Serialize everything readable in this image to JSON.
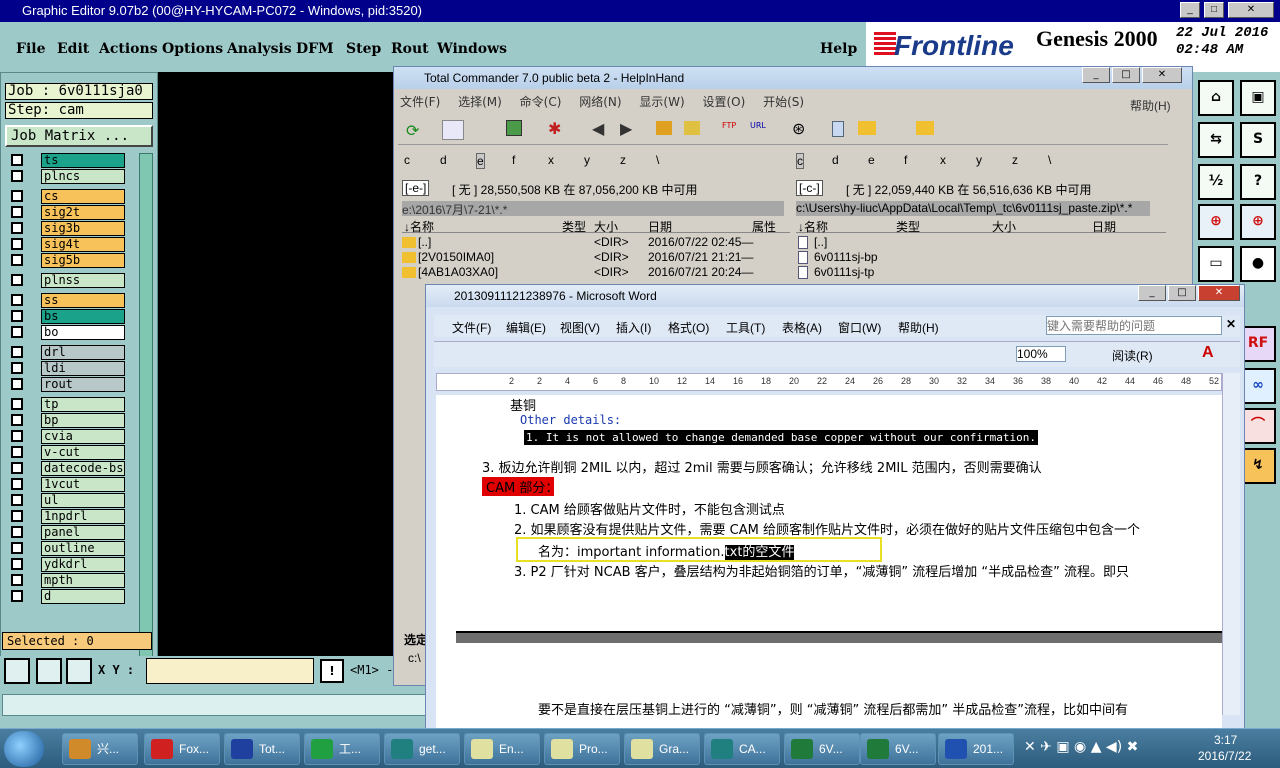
{
  "genesis": {
    "title": "Graphic Editor 9.07b2 (00@HY-HYCAM-PC072 - Windows, pid:3520)",
    "menu": [
      "File",
      "Edit",
      "Actions",
      "Options",
      "Analysis",
      "DFM",
      "Step",
      "Rout",
      "Windows",
      "Help"
    ],
    "brand": "Frontline",
    "product": "Genesis 2000",
    "date": "22 Jul 2016",
    "time": "02:48 AM",
    "subtitle": "Graphic Editor",
    "job": "Job : 6v0111sja0",
    "step": "Step: cam",
    "job_matrix": "Job Matrix ...",
    "layers": [
      {
        "name": "ts",
        "color": "#1aa38a"
      },
      {
        "name": "plncs",
        "color": "#c9e6c9"
      },
      {
        "name": "cs",
        "color": "#f7c25a"
      },
      {
        "name": "sig2t",
        "color": "#f7c25a"
      },
      {
        "name": "sig3b",
        "color": "#f7c25a"
      },
      {
        "name": "sig4t",
        "color": "#f7c25a"
      },
      {
        "name": "sig5b",
        "color": "#f7c25a"
      },
      {
        "name": "plnss",
        "color": "#c9e6c9"
      },
      {
        "name": "ss",
        "color": "#f7c25a"
      },
      {
        "name": "bs",
        "color": "#1aa38a"
      },
      {
        "name": "bo",
        "color": "#ffffff"
      },
      {
        "name": "drl",
        "color": "#b8c8c8"
      },
      {
        "name": "ldi",
        "color": "#b8c8c8"
      },
      {
        "name": "rout",
        "color": "#b8c8c8"
      },
      {
        "name": "tp",
        "color": "#c9e6c9"
      },
      {
        "name": "bp",
        "color": "#c9e6c9"
      },
      {
        "name": "cvia",
        "color": "#c9e6c9"
      },
      {
        "name": "v-cut",
        "color": "#c9e6c9"
      },
      {
        "name": "datecode-bs",
        "color": "#c9e6c9"
      },
      {
        "name": "1vcut",
        "color": "#c9e6c9"
      },
      {
        "name": "ul",
        "color": "#c9e6c9"
      },
      {
        "name": "1npdrl",
        "color": "#c9e6c9"
      },
      {
        "name": "panel",
        "color": "#c9e6c9"
      },
      {
        "name": "outline",
        "color": "#c9e6c9"
      },
      {
        "name": "ydkdrl",
        "color": "#c9e6c9"
      },
      {
        "name": "mpth",
        "color": "#c9e6c9"
      },
      {
        "name": "d",
        "color": "#c9e6c9"
      }
    ],
    "selected": "Selected : 0",
    "xy_label": "X Y :",
    "m1": "<M1> -"
  },
  "tc": {
    "title": "Total Commander 7.0 public beta 2 - HelpInHand",
    "menu": [
      "文件(F)",
      "选择(M)",
      "命令(C)",
      "网络(N)",
      "显示(W)",
      "设置(O)",
      "开始(S)",
      "帮助(H)"
    ],
    "left_drives": [
      "c",
      "d",
      "e",
      "f",
      "x",
      "y",
      "z",
      "\\"
    ],
    "right_drives": [
      "c",
      "d",
      "e",
      "f",
      "x",
      "y",
      "z",
      "\\"
    ],
    "left_drive_sel": "[-e-]",
    "left_free": "[ 无 ]  28,550,508 KB 在 87,056,200 KB 中可用",
    "right_drive_sel": "[-c-]",
    "right_free": "[ 无 ]  22,059,440 KB 在 56,516,636 KB 中可用",
    "left_path": "e:\\2016\\7月\\7-21\\*.*",
    "right_path": "c:\\Users\\hy-liuc\\AppData\\Local\\Temp\\_tc\\6v0111sj_paste.zip\\*.*",
    "left_cols": [
      "↓名称",
      "类型",
      "大小",
      "日期",
      "属性"
    ],
    "right_cols": [
      "↓名称",
      "类型",
      "大小",
      "日期"
    ],
    "left_files": [
      {
        "name": "[..]",
        "size": "<DIR>",
        "date": "2016/07/22 02:45—"
      },
      {
        "name": "[2V0150IMA0]",
        "size": "<DIR>",
        "date": "2016/07/21 21:21—"
      },
      {
        "name": "[4AB1A03XA0]",
        "size": "<DIR>",
        "date": "2016/07/21 20:24—"
      }
    ],
    "right_files": [
      "[..]",
      "6v0111sj-bp",
      "6v0111sj-tp"
    ],
    "selected_label": "选定",
    "cmd": "c:\\"
  },
  "word": {
    "title": "20130911121238976 - Microsoft Word",
    "menu": [
      "文件(F)",
      "编辑(E)",
      "视图(V)",
      "插入(I)",
      "格式(O)",
      "工具(T)",
      "表格(A)",
      "窗口(W)",
      "帮助(H)"
    ],
    "help_placeholder": "键入需要帮助的问题",
    "zoom": "100%",
    "read": "阅读(R)",
    "ruler": [
      "2",
      "2",
      "4",
      "6",
      "8",
      "10",
      "12",
      "14",
      "16",
      "18",
      "20",
      "22",
      "24",
      "26",
      "28",
      "30",
      "32",
      "34",
      "36",
      "38",
      "40",
      "42",
      "44",
      "46",
      "48",
      "52"
    ],
    "lines": {
      "l1": "基铜",
      "l2": "Other details:",
      "l3": "1. It is not allowed to change demanded base copper without our confirmation.",
      "l4": "3.  板边允许削铜 2MIL 以内，超过 2mil 需要与顾客确认；允许移线 2MIL 范围内，否则需要确认",
      "l5": "CAM 部分：",
      "l6": "1.  CAM 给顾客做贴片文件时，不能包含测试点",
      "l7": "2.  如果顾客没有提供贴片文件，需要 CAM 给顾客制作贴片文件时，必须在做好的贴片文件压缩包中包含一个",
      "l8a": "名为：important information.",
      "l8b": "txt",
      "l8c": "的空文件",
      "l9": "3.  P2 厂针对 NCAB 客户，叠层结构为非起始铜箔的订单，“减薄铜” 流程后增加 “半成品检查” 流程。即只",
      "l10": "要不是直接在层压基铜上进行的 “减薄铜”，则 “减薄铜” 流程后都需加” 半成品检查”流程，比如中间有"
    }
  },
  "taskbar": {
    "items": [
      {
        "label": "兴...",
        "color": "#d08a2a"
      },
      {
        "label": "Fox...",
        "color": "#d02020"
      },
      {
        "label": "Tot...",
        "color": "#2040a0"
      },
      {
        "label": "工...",
        "color": "#20a040"
      },
      {
        "label": "get...",
        "color": "#208080"
      },
      {
        "label": "En...",
        "color": "#e0e0a0"
      },
      {
        "label": "Pro...",
        "color": "#e0e0a0"
      },
      {
        "label": "Gra...",
        "color": "#e0e0a0"
      },
      {
        "label": "CA...",
        "color": "#208080"
      },
      {
        "label": "6V...",
        "color": "#207a3a"
      },
      {
        "label": "6V...",
        "color": "#207a3a"
      },
      {
        "label": "201...",
        "color": "#2050b0"
      }
    ],
    "time": "3:17",
    "date": "2016/7/22"
  }
}
